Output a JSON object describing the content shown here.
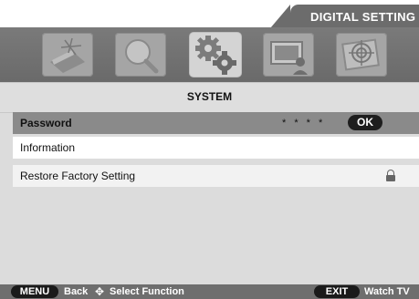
{
  "header": {
    "title": "DIGITAL SETTING"
  },
  "icon_bar": {
    "items": [
      {
        "name": "picture-settings-icon"
      },
      {
        "name": "search-icon"
      },
      {
        "name": "gears-icon",
        "active": true
      },
      {
        "name": "screen-person-icon"
      },
      {
        "name": "target-icon"
      }
    ]
  },
  "section": {
    "title": "SYSTEM"
  },
  "menu": {
    "items": [
      {
        "label": "Password",
        "value": "* * * *",
        "ok": "OK"
      },
      {
        "label": "Information"
      },
      {
        "label": "Restore Factory Setting",
        "icon": "lock-icon"
      }
    ]
  },
  "footer": {
    "menu_key": "MENU",
    "back": "Back",
    "select": "Select Function",
    "exit_key": "EXIT",
    "watch": "Watch TV"
  }
}
